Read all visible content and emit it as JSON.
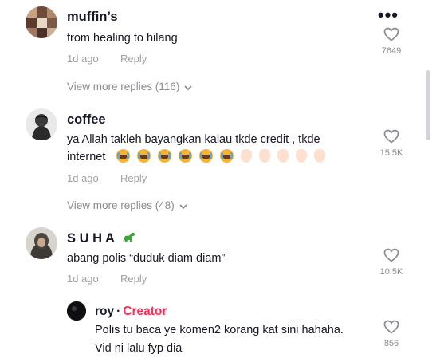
{
  "colors": {
    "accent": "#fe2c55",
    "muted": "#a0a0a8",
    "text": "#161823"
  },
  "comments": [
    {
      "username": "muffin’s",
      "text_lines": [
        "from healing to hilang"
      ],
      "date": "1d ago",
      "reply_label": "Reply",
      "likes": "7649",
      "view_more": "View more replies (116)"
    },
    {
      "username": "coffee",
      "text_lines": [
        "ya Allah takleh bayangkan kalau tkde credit , tkde",
        "internet"
      ],
      "emoji_icons": [
        "loudly-crying-face",
        "loudly-crying-face",
        "loudly-crying-face",
        "loudly-crying-face",
        "loudly-crying-face",
        "loudly-crying-face",
        "raised-hand-light",
        "raised-hand-light",
        "raised-hand-light",
        "raised-hand-light",
        "raised-hand-light"
      ],
      "date": "1d ago",
      "reply_label": "Reply",
      "likes": "15.5K",
      "view_more": "View more replies (48)"
    },
    {
      "username": "S U H A",
      "username_emoji": "dinosaur-icon",
      "text_lines": [
        "abang polis “duduk diam diam”"
      ],
      "date": "1d ago",
      "reply_label": "Reply",
      "likes": "10.5K"
    }
  ],
  "reply": {
    "username": "roy",
    "separator": "·",
    "badge": "Creator",
    "text_lines": [
      "Polis tu baca ye komen2 korang kat sini hahaha.",
      "Vid ni lalu fyp dia"
    ],
    "likes": "856"
  }
}
